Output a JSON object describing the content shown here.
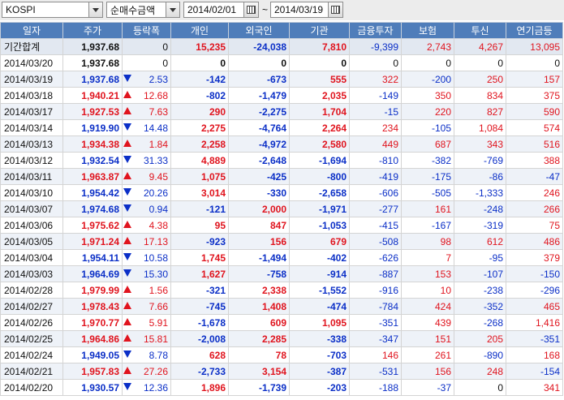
{
  "toolbar": {
    "market": "KOSPI",
    "metric": "순매수금액",
    "date_from": "2014/02/01",
    "date_sep": "~",
    "date_to": "2014/03/19"
  },
  "columns": [
    "일자",
    "주가",
    "등락폭",
    "개인",
    "외국인",
    "기관",
    "금융투자",
    "보험",
    "투신",
    "연기금등"
  ],
  "colors": {
    "header_bg": "#4f7dba",
    "up": "#e0141e",
    "down": "#0b2fc7"
  },
  "rows": [
    {
      "date": "기간합계",
      "price": "1,937.68",
      "dir": "",
      "chg": "0",
      "indiv": "15,235",
      "foreign": "-24,038",
      "inst": "7,810",
      "fin": "-9,399",
      "ins": "2,743",
      "trust": "4,267",
      "pension": "13,095",
      "sum": true
    },
    {
      "date": "2014/03/20",
      "price": "1,937.68",
      "dir": "",
      "chg": "0",
      "indiv": "0",
      "foreign": "0",
      "inst": "0",
      "fin": "0",
      "ins": "0",
      "trust": "0",
      "pension": "0"
    },
    {
      "date": "2014/03/19",
      "price": "1,937.68",
      "dir": "down",
      "chg": "2.53",
      "indiv": "-142",
      "foreign": "-673",
      "inst": "555",
      "fin": "322",
      "ins": "-200",
      "trust": "250",
      "pension": "157"
    },
    {
      "date": "2014/03/18",
      "price": "1,940.21",
      "dir": "up",
      "chg": "12.68",
      "indiv": "-802",
      "foreign": "-1,479",
      "inst": "2,035",
      "fin": "-149",
      "ins": "350",
      "trust": "834",
      "pension": "375"
    },
    {
      "date": "2014/03/17",
      "price": "1,927.53",
      "dir": "up",
      "chg": "7.63",
      "indiv": "290",
      "foreign": "-2,275",
      "inst": "1,704",
      "fin": "-15",
      "ins": "220",
      "trust": "827",
      "pension": "590"
    },
    {
      "date": "2014/03/14",
      "price": "1,919.90",
      "dir": "down",
      "chg": "14.48",
      "indiv": "2,275",
      "foreign": "-4,764",
      "inst": "2,264",
      "fin": "234",
      "ins": "-105",
      "trust": "1,084",
      "pension": "574"
    },
    {
      "date": "2014/03/13",
      "price": "1,934.38",
      "dir": "up",
      "chg": "1.84",
      "indiv": "2,258",
      "foreign": "-4,972",
      "inst": "2,580",
      "fin": "449",
      "ins": "687",
      "trust": "343",
      "pension": "516"
    },
    {
      "date": "2014/03/12",
      "price": "1,932.54",
      "dir": "down",
      "chg": "31.33",
      "indiv": "4,889",
      "foreign": "-2,648",
      "inst": "-1,694",
      "fin": "-810",
      "ins": "-382",
      "trust": "-769",
      "pension": "388"
    },
    {
      "date": "2014/03/11",
      "price": "1,963.87",
      "dir": "up",
      "chg": "9.45",
      "indiv": "1,075",
      "foreign": "-425",
      "inst": "-800",
      "fin": "-419",
      "ins": "-175",
      "trust": "-86",
      "pension": "-47"
    },
    {
      "date": "2014/03/10",
      "price": "1,954.42",
      "dir": "down",
      "chg": "20.26",
      "indiv": "3,014",
      "foreign": "-330",
      "inst": "-2,658",
      "fin": "-606",
      "ins": "-505",
      "trust": "-1,333",
      "pension": "246"
    },
    {
      "date": "2014/03/07",
      "price": "1,974.68",
      "dir": "down",
      "chg": "0.94",
      "indiv": "-121",
      "foreign": "2,000",
      "inst": "-1,971",
      "fin": "-277",
      "ins": "161",
      "trust": "-248",
      "pension": "266"
    },
    {
      "date": "2014/03/06",
      "price": "1,975.62",
      "dir": "up",
      "chg": "4.38",
      "indiv": "95",
      "foreign": "847",
      "inst": "-1,053",
      "fin": "-415",
      "ins": "-167",
      "trust": "-319",
      "pension": "75"
    },
    {
      "date": "2014/03/05",
      "price": "1,971.24",
      "dir": "up",
      "chg": "17.13",
      "indiv": "-923",
      "foreign": "156",
      "inst": "679",
      "fin": "-508",
      "ins": "98",
      "trust": "612",
      "pension": "486"
    },
    {
      "date": "2014/03/04",
      "price": "1,954.11",
      "dir": "down",
      "chg": "10.58",
      "indiv": "1,745",
      "foreign": "-1,494",
      "inst": "-402",
      "fin": "-626",
      "ins": "7",
      "trust": "-95",
      "pension": "379"
    },
    {
      "date": "2014/03/03",
      "price": "1,964.69",
      "dir": "down",
      "chg": "15.30",
      "indiv": "1,627",
      "foreign": "-758",
      "inst": "-914",
      "fin": "-887",
      "ins": "153",
      "trust": "-107",
      "pension": "-150"
    },
    {
      "date": "2014/02/28",
      "price": "1,979.99",
      "dir": "up",
      "chg": "1.56",
      "indiv": "-321",
      "foreign": "2,338",
      "inst": "-1,552",
      "fin": "-916",
      "ins": "10",
      "trust": "-238",
      "pension": "-296"
    },
    {
      "date": "2014/02/27",
      "price": "1,978.43",
      "dir": "up",
      "chg": "7.66",
      "indiv": "-745",
      "foreign": "1,408",
      "inst": "-474",
      "fin": "-784",
      "ins": "424",
      "trust": "-352",
      "pension": "465"
    },
    {
      "date": "2014/02/26",
      "price": "1,970.77",
      "dir": "up",
      "chg": "5.91",
      "indiv": "-1,678",
      "foreign": "609",
      "inst": "1,095",
      "fin": "-351",
      "ins": "439",
      "trust": "-268",
      "pension": "1,416"
    },
    {
      "date": "2014/02/25",
      "price": "1,964.86",
      "dir": "up",
      "chg": "15.81",
      "indiv": "-2,008",
      "foreign": "2,285",
      "inst": "-338",
      "fin": "-347",
      "ins": "151",
      "trust": "205",
      "pension": "-351"
    },
    {
      "date": "2014/02/24",
      "price": "1,949.05",
      "dir": "down",
      "chg": "8.78",
      "indiv": "628",
      "foreign": "78",
      "inst": "-703",
      "fin": "146",
      "ins": "261",
      "trust": "-890",
      "pension": "168"
    },
    {
      "date": "2014/02/21",
      "price": "1,957.83",
      "dir": "up",
      "chg": "27.26",
      "indiv": "-2,733",
      "foreign": "3,154",
      "inst": "-387",
      "fin": "-531",
      "ins": "156",
      "trust": "248",
      "pension": "-154"
    },
    {
      "date": "2014/02/20",
      "price": "1,930.57",
      "dir": "down",
      "chg": "12.36",
      "indiv": "1,896",
      "foreign": "-1,739",
      "inst": "-203",
      "fin": "-188",
      "ins": "-37",
      "trust": "0",
      "pension": "341"
    }
  ]
}
